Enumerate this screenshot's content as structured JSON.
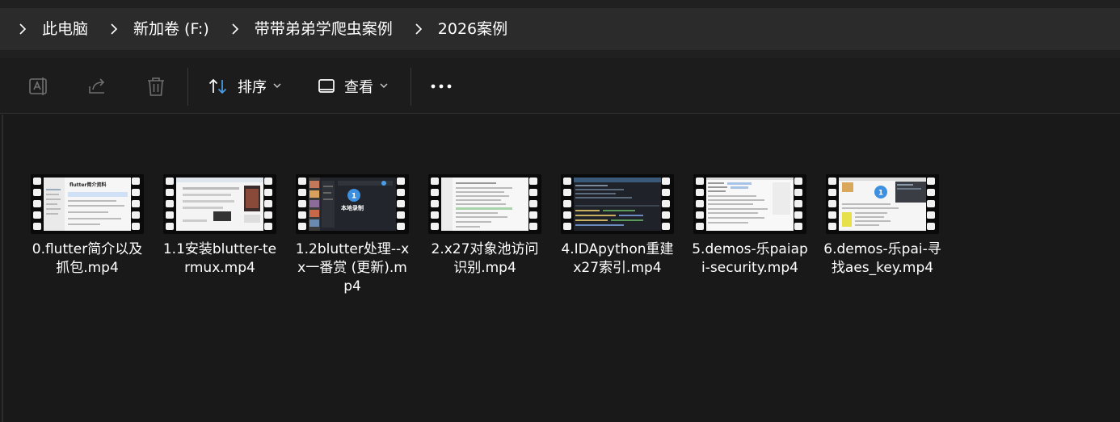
{
  "breadcrumb": [
    "此电脑",
    "新加卷 (F:)",
    "带带弟弟学爬虫案例",
    "2026案例"
  ],
  "toolbar": {
    "sort_label": "排序",
    "view_label": "查看"
  },
  "icons": {
    "rename": "rename-icon",
    "share": "share-icon",
    "delete": "trash-icon",
    "sort": "sort-arrows-icon",
    "view": "view-icon",
    "more": "more-icon",
    "chevron": "chevron-down-icon",
    "separator": "chevron-right-icon"
  },
  "colors": {
    "background": "#191919",
    "addressbar": "#2b2b2b",
    "accent": "#4a9ee8"
  },
  "files": [
    {
      "name": "0.flutter简介以及抓包.mp4",
      "thumb_text": "flutter简介资料"
    },
    {
      "name": "1.1安装blutter-termux.mp4",
      "thumb_text": ""
    },
    {
      "name": "1.2blutter处理--xx一番赏 (更新).mp4",
      "thumb_text": "本地录制",
      "badge": "1"
    },
    {
      "name": "2.x27对象池访问识别.mp4",
      "thumb_text": ""
    },
    {
      "name": "4.IDApython重建x27索引.mp4",
      "thumb_text": ""
    },
    {
      "name": "5.demos-乐paiapi-security.mp4",
      "thumb_text": ""
    },
    {
      "name": "6.demos-乐pai-寻找aes_key.mp4",
      "thumb_text": "",
      "badge": "1"
    }
  ]
}
